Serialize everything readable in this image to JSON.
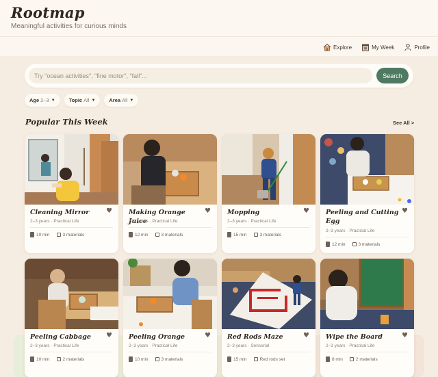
{
  "brand": {
    "title": "Rootmap",
    "tagline": "Meaningful activities for curious minds"
  },
  "nav": [
    {
      "label": "Explore",
      "icon": "house-icon"
    },
    {
      "label": "My Week",
      "icon": "calendar-icon"
    },
    {
      "label": "Profile",
      "icon": "person-icon"
    }
  ],
  "search": {
    "placeholder": "Try \"ocean activities\", \"fine motor\", \"fall\"...",
    "value": "",
    "button": "Search"
  },
  "filters": [
    {
      "name": "Age",
      "value": "2–3"
    },
    {
      "name": "Topic",
      "value": "All"
    },
    {
      "name": "Area",
      "value": "All"
    }
  ],
  "section": {
    "title": "Popular This Week",
    "see_all": "See All >"
  },
  "cards": [
    {
      "title": "Cleaning Mirror",
      "meta": "2–3 years · Practical Life",
      "time": "10 min",
      "materials": "3 materials"
    },
    {
      "title": "Making Orange Juice",
      "meta": "2–3 years · Practical Life",
      "time": "12 min",
      "materials": "3 materials"
    },
    {
      "title": "Mopping",
      "meta": "2–3 years · Practical Life",
      "time": "15 min",
      "materials": "3 materials"
    },
    {
      "title": "Peeling and Cutting Egg",
      "meta": "2–3 years · Practical Life",
      "time": "12 min",
      "materials": "3 materials"
    },
    {
      "title": "Peeling Cabbage",
      "meta": "2–3 years · Practical Life",
      "time": "10 min",
      "materials": "2 materials"
    },
    {
      "title": "Peeling Orange",
      "meta": "2–3 years · Practical Life",
      "time": "10 min",
      "materials": "3 materials"
    },
    {
      "title": "Red Rods Maze",
      "meta": "2–3 years · Sensorial",
      "time": "15 min",
      "materials": "Red rods set"
    },
    {
      "title": "Wipe the Board",
      "meta": "2–3 years · Practical Life",
      "time": "8 min",
      "materials": "2 materials"
    }
  ],
  "colors": {
    "accent": "#4f7a62",
    "background": "#f6ede2",
    "header": "#fcf8f1",
    "card": "#fffdf9"
  }
}
